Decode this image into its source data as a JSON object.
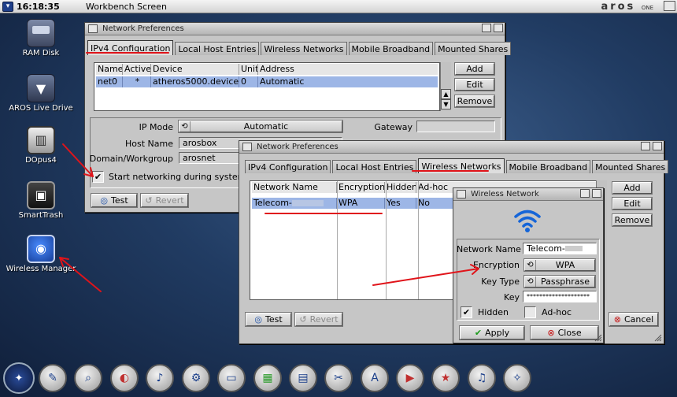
{
  "screen": {
    "clock": "16:18:35",
    "title": "Workbench Screen",
    "brand": "aros",
    "brand_suffix": "ONE"
  },
  "desktop_icons": [
    {
      "label": "RAM Disk",
      "icon": "ram-disk-icon"
    },
    {
      "label": "AROS Live Drive",
      "icon": "drive-icon"
    },
    {
      "label": "DOpus4",
      "icon": "dopus-icon"
    },
    {
      "label": "SmartTrash",
      "icon": "trash-icon"
    },
    {
      "label": "Wireless Manager",
      "icon": "wifi-icon"
    }
  ],
  "win1": {
    "title": "Network Preferences",
    "tabs": [
      "IPv4 Configuration",
      "Local Host Entries",
      "Wireless Networks",
      "Mobile Broadband",
      "Mounted Shares"
    ],
    "active_tab": 0,
    "columns": [
      "Name",
      "Active",
      "Device",
      "Unit",
      "Address"
    ],
    "rows": [
      {
        "name": "net0",
        "active": "*",
        "device": "atheros5000.device",
        "unit": "0",
        "address": "Automatic"
      }
    ],
    "buttons": {
      "add": "Add",
      "edit": "Edit",
      "remove": "Remove",
      "test": "Test",
      "revert": "Revert"
    },
    "ip_mode_label": "IP Mode",
    "ip_mode_value": "Automatic",
    "host_name_label": "Host Name",
    "host_name_value": "arosbox",
    "domain_label": "Domain/Workgroup",
    "domain_value": "arosnet",
    "gateway_label": "Gateway",
    "start_networking_label": "Start networking during system"
  },
  "win2": {
    "title": "Network Preferences",
    "tabs": [
      "IPv4 Configuration",
      "Local Host Entries",
      "Wireless Networks",
      "Mobile Broadband",
      "Mounted Shares"
    ],
    "active_tab": 2,
    "columns": [
      "Network Name",
      "Encryption",
      "Hidden",
      "Ad-hoc"
    ],
    "rows": [
      {
        "network_name": "Telecom-",
        "encryption": "WPA",
        "hidden": "Yes",
        "adhoc": "No"
      }
    ],
    "buttons": {
      "add": "Add",
      "edit": "Edit",
      "remove": "Remove",
      "test": "Test",
      "revert": "Revert",
      "cancel": "Cancel"
    }
  },
  "win3": {
    "title": "Wireless Network",
    "network_name_label": "Network Name",
    "network_name_value": "Telecom-",
    "encryption_label": "Encryption",
    "encryption_value": "WPA",
    "key_type_label": "Key Type",
    "key_type_value": "Passphrase",
    "key_label": "Key",
    "key_value": "********************",
    "hidden_label": "Hidden",
    "hidden_checked": true,
    "adhoc_label": "Ad-hoc",
    "adhoc_checked": false,
    "apply_label": "Apply",
    "close_label": "Close"
  },
  "colors": {
    "selection": "#9db6e6",
    "annotation": "#e0141a",
    "window_bg": "#c6c6c6"
  }
}
